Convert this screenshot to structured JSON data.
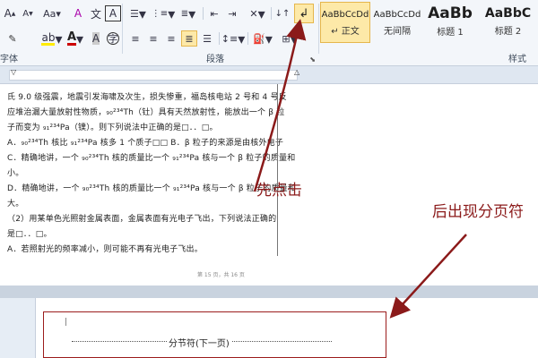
{
  "ribbon": {
    "font_group_label": "字体",
    "paragraph_group_label": "段落",
    "styles_group_label": "样式",
    "font_size_label": "A",
    "case_label": "Aa",
    "clear_format_label": "A",
    "char_border_label": "A",
    "phonetic_label": "文",
    "enclose_label": "字",
    "styles": [
      {
        "sample": "AaBbCcDd",
        "name": "↵ 正文"
      },
      {
        "sample": "AaBbCcDd",
        "name": "无间隔"
      },
      {
        "sample": "AaBb",
        "name": "标题 1"
      },
      {
        "sample": "AaBbC",
        "name": "标题 2"
      }
    ]
  },
  "document": {
    "lines": [
      "氏 9.0 级强震，地震引发海啸及次生，损失惨重，福岛核电站 2 号和 4 号反",
      "应堆治漏大量放射性物质，₉₀²³⁴Th（钍）具有天然放射性，能放出一个 β 粒",
      "子而变为 ₉₁²³⁴Pa（镤）。则下列说法中正确的是□．．□。",
      "A．₉₀²³⁴Th 核比 ₉₁²³⁴Pa 核多 1 个质子□□ B．β 粒子的来源是由核外电子",
      "C．精确地讲，一个 ₉₀²³⁴Th 核的质量比一个 ₉₁²³⁴Pa 核与一个 β 粒子的质量和",
      "小。",
      "D．精确地讲，一个 ₉₀²³⁴Th 核的质量比一个 ₉₁²³⁴Pa 核与一个 β 粒子的质量和",
      "大。",
      "（2）用某单色光照射金属表面，金属表面有光电子飞出，下列说法正确的",
      "是□．．□。",
      "A．若照射光的频率减小，则可能不再有光电子飞出。"
    ],
    "footer": "第 15 页，共 16 页",
    "page2_marker": "|",
    "section_break": "分节符(下一页)"
  },
  "annotations": {
    "first_click": "先点击",
    "then_appears": "后出现分页符"
  },
  "colors": {
    "annotation": "#8b1a1a",
    "ribbon_bg": "#f3f6fa",
    "active_style": "#fde9a8"
  }
}
